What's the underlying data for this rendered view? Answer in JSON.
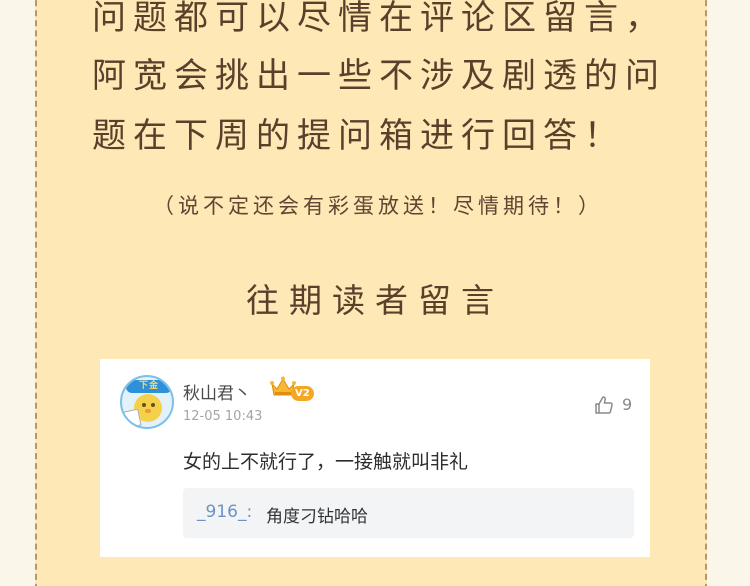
{
  "intro": {
    "lines": [
      "问题都可以尽情在评论区留言，",
      "阿宽会挑出一些不涉及剧透的问",
      "题在下周的提问箱进行回答！"
    ],
    "aside": "（说不定还会有彩蛋放送！尽情期待！）",
    "section_title": "往期读者留言"
  },
  "comment": {
    "avatar_badge": "下金",
    "username": "秋山君丶",
    "level_badge": "V2",
    "timestamp": "12-05 10:43",
    "likes": "9",
    "text": "女的上不就行了，一接触就叫非礼",
    "reply": {
      "author": "_916_:",
      "text": "角度刁钻哈哈"
    }
  },
  "icons": {
    "crown": "crown-icon",
    "like": "thumbs-up-icon",
    "avatar": "chick-avatar"
  },
  "colors": {
    "card_background": "#fde8b6",
    "card_border": "#b79768",
    "heading_text": "#5a3f2b",
    "reply_author": "#6b93c4",
    "badge": "#f5a623"
  }
}
